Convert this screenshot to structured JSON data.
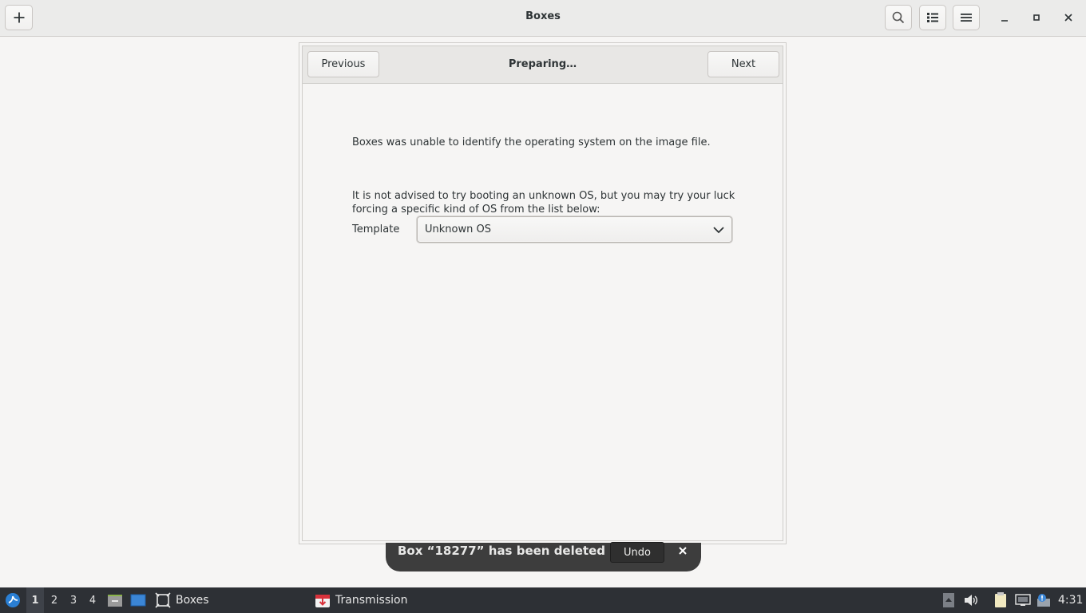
{
  "header": {
    "title": "Boxes",
    "new_icon": "plus-icon",
    "search_icon": "search-icon",
    "view_icon": "list-view-icon",
    "menu_icon": "hamburger-menu-icon"
  },
  "assistant": {
    "previous_label": "Previous",
    "page_title": "Preparing…",
    "next_label": "Next",
    "message_1": "Boxes was unable to identify the operating system on the image file.",
    "message_2_line1": "It is not advised to try booting an unknown OS, but you may try your luck",
    "message_2_line2": "forcing a specific kind of OS from the list below:",
    "template_label": "Template",
    "template_value": "Unknown OS"
  },
  "toast": {
    "text": "Box “18277” has been deleted",
    "undo_label": "Undo"
  },
  "taskbar": {
    "workspaces": [
      "1",
      "2",
      "3",
      "4"
    ],
    "active_workspace": "1",
    "tasks": [
      {
        "label": "Boxes",
        "icon": "boxes-app-icon"
      },
      {
        "label": "Transmission",
        "icon": "transmission-app-icon"
      }
    ],
    "clock": "4:31"
  },
  "colors": {
    "taskbar_bg": "#2d3035",
    "toast_bg": "#3d3d3d",
    "window_bg": "#f6f5f4"
  }
}
